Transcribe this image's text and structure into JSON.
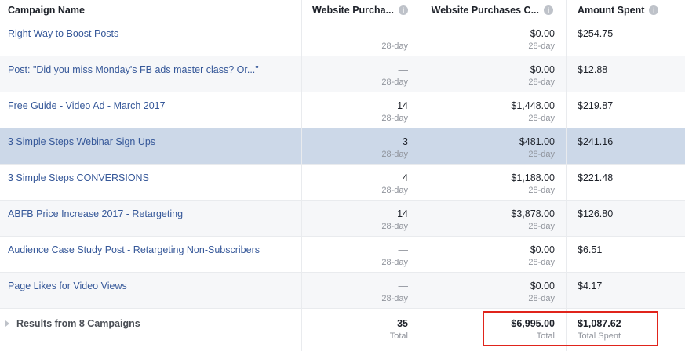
{
  "header": {
    "col_name": "Campaign Name",
    "col_purchases": "Website Purcha...",
    "col_purchase_value": "Website Purchases C...",
    "col_spent": "Amount Spent",
    "info_glyph": "i"
  },
  "rows": [
    {
      "name": "Right Way to Boost Posts",
      "purchases": "—",
      "purchases_sub": "28-day",
      "value": "$0.00",
      "value_sub": "28-day",
      "spent": "$254.75"
    },
    {
      "name": "Post: \"Did you miss Monday's FB ads master class? Or...\"",
      "purchases": "—",
      "purchases_sub": "28-day",
      "value": "$0.00",
      "value_sub": "28-day",
      "spent": "$12.88"
    },
    {
      "name": "Free Guide - Video Ad - March 2017",
      "purchases": "14",
      "purchases_sub": "28-day",
      "value": "$1,448.00",
      "value_sub": "28-day",
      "spent": "$219.87"
    },
    {
      "name": "3 Simple Steps Webinar Sign Ups",
      "purchases": "3",
      "purchases_sub": "28-day",
      "value": "$481.00",
      "value_sub": "28-day",
      "spent": "$241.16"
    },
    {
      "name": "3 Simple Steps CONVERSIONS",
      "purchases": "4",
      "purchases_sub": "28-day",
      "value": "$1,188.00",
      "value_sub": "28-day",
      "spent": "$221.48"
    },
    {
      "name": "ABFB Price Increase 2017 - Retargeting",
      "purchases": "14",
      "purchases_sub": "28-day",
      "value": "$3,878.00",
      "value_sub": "28-day",
      "spent": "$126.80"
    },
    {
      "name": "Audience Case Study Post - Retargeting Non-Subscribers",
      "purchases": "—",
      "purchases_sub": "28-day",
      "value": "$0.00",
      "value_sub": "28-day",
      "spent": "$6.51"
    },
    {
      "name": "Page Likes for Video Views",
      "purchases": "—",
      "purchases_sub": "28-day",
      "value": "$0.00",
      "value_sub": "28-day",
      "spent": "$4.17"
    }
  ],
  "footer": {
    "label": "Results from 8 Campaigns",
    "purchases": "35",
    "purchases_sub": "Total",
    "value": "$6,995.00",
    "value_sub": "Total",
    "spent": "$1,087.62",
    "spent_sub": "Total Spent"
  },
  "colors": {
    "link": "#365899",
    "selected_row": "#ccd8e8",
    "highlight_border": "#e0241b"
  }
}
